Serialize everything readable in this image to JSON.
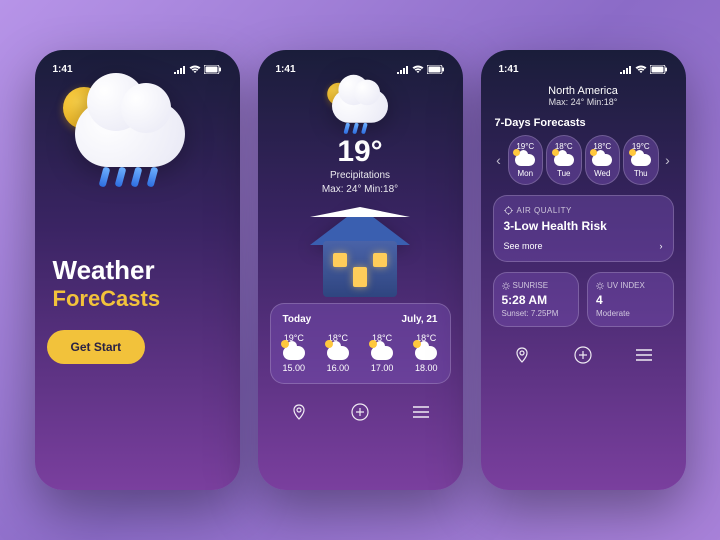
{
  "status_bar": {
    "time": "1:41"
  },
  "screen1": {
    "title_line1": "Weather",
    "title_line2": "ForeCasts",
    "cta": "Get Start"
  },
  "screen2": {
    "temp": "19°",
    "sub1": "Precipitations",
    "sub2": "Max: 24°  Min:18°",
    "today": {
      "label": "Today",
      "date": "July, 21"
    },
    "hours": [
      {
        "temp": "19°C",
        "time": "15.00"
      },
      {
        "temp": "18°C",
        "time": "16.00"
      },
      {
        "temp": "18°C",
        "time": "17.00"
      },
      {
        "temp": "18°C",
        "time": "18.00"
      }
    ]
  },
  "screen3": {
    "location": "North America",
    "maxmin": "Max: 24°  Min:18°",
    "forecast_title": "7-Days Forecasts",
    "days": [
      {
        "temp": "19°C",
        "day": "Mon"
      },
      {
        "temp": "18°C",
        "day": "Tue"
      },
      {
        "temp": "18°C",
        "day": "Wed"
      },
      {
        "temp": "19°C",
        "day": "Thu"
      }
    ],
    "air_quality": {
      "label": "AIR QUALITY",
      "value": "3-Low Health Risk",
      "see_more": "See more"
    },
    "sunrise": {
      "label": "SUNRISE",
      "value": "5:28 AM",
      "sub": "Sunset: 7.25PM"
    },
    "uv": {
      "label": "UV INDEX",
      "value": "4",
      "sub": "Moderate"
    }
  }
}
